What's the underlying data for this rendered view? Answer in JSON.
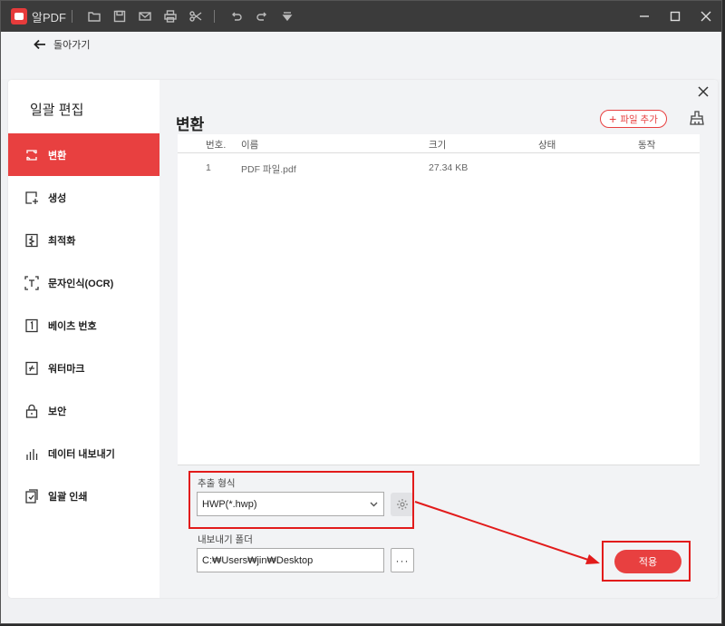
{
  "app": {
    "name": "알PDF"
  },
  "backrow": {
    "back_label": "돌아가기"
  },
  "sidebar": {
    "title": "일괄 편집",
    "items": [
      {
        "label": "변환",
        "icon": "convert-icon",
        "active": true
      },
      {
        "label": "생성",
        "icon": "create-icon",
        "active": false
      },
      {
        "label": "최적화",
        "icon": "optimize-icon",
        "active": false
      },
      {
        "label": "문자인식(OCR)",
        "icon": "ocr-icon",
        "active": false
      },
      {
        "label": "베이츠 번호",
        "icon": "bates-number-icon",
        "active": false
      },
      {
        "label": "워터마크",
        "icon": "watermark-icon",
        "active": false
      },
      {
        "label": "보안",
        "icon": "lock-icon",
        "active": false
      },
      {
        "label": "데이터 내보내기",
        "icon": "chart-icon",
        "active": false
      },
      {
        "label": "일괄 인쇄",
        "icon": "print-doc-icon",
        "active": false
      }
    ]
  },
  "main": {
    "title": "변환",
    "add_file_label": "파일 추가",
    "table": {
      "headers": [
        "번호.",
        "이름",
        "크기",
        "상태",
        "동작"
      ],
      "rows": [
        {
          "no": "1",
          "name": "PDF 파일.pdf",
          "size": "27.34 KB",
          "status": "",
          "action": ""
        }
      ]
    },
    "format_label": "추출 형식",
    "format_value": "HWP(*.hwp)",
    "output_label": "내보내기 폴더",
    "output_value": "C:₩Users₩jin₩Desktop",
    "browse_label": "···",
    "apply_label": "적용"
  },
  "colors": {
    "accent": "#e84040",
    "highlight": "#e21b1b",
    "titlebar": "#3b3b3b"
  }
}
